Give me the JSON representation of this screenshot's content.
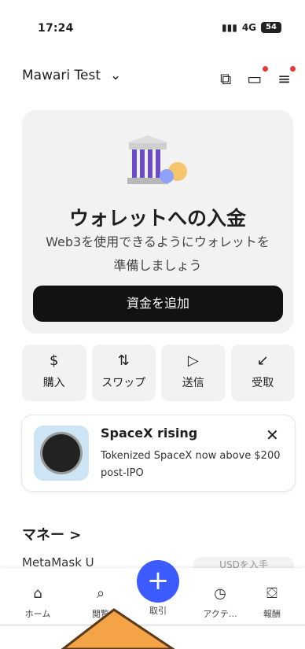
{
  "status": {
    "time": "17:24",
    "network": "4G",
    "battery": "54"
  },
  "header": {
    "account_name": "Mawari Test",
    "chevron": "chevron-down-icon"
  },
  "card": {
    "title": "ウォレットへの入金",
    "subtitle_line1": "Web3を使用できるようにウォレットを",
    "subtitle_line2": "準備しましょう",
    "button": "資金を追加"
  },
  "actions": [
    {
      "icon": "$",
      "label": "購入"
    },
    {
      "icon": "⇅",
      "label": "スワップ"
    },
    {
      "icon": "▷",
      "label": "送信"
    },
    {
      "icon": "↙",
      "label": "受取"
    }
  ],
  "promo": {
    "title": "SpaceX rising",
    "body": "Tokenized SpaceX now above $200 post-IPO",
    "close": "✕"
  },
  "money": {
    "title": "マネー >",
    "row": "MetaMask U",
    "pill": "USDを入手"
  },
  "nav": {
    "home": "ホーム",
    "browse": "閲覧",
    "trade": "取引",
    "activity": "アクテ…",
    "rewards": "報酬"
  },
  "colors": {
    "accent": "#3b5bff",
    "dark_button": "#121212",
    "card_bg": "#f2f2f2",
    "badge": "#e23b37"
  }
}
